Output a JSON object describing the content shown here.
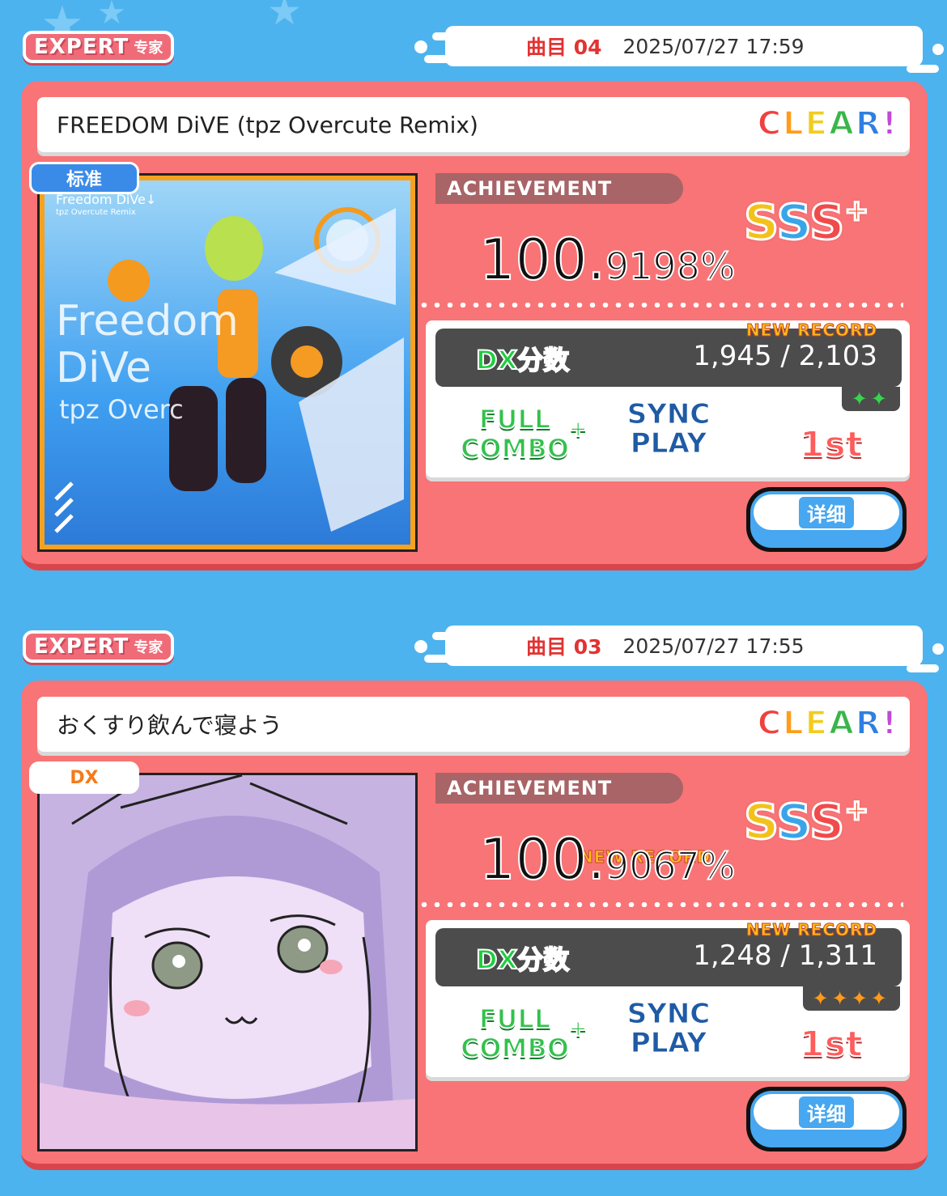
{
  "colors": {
    "background": "#4db3ee",
    "card": "#f87476",
    "accent_red": "#e23333"
  },
  "records": [
    {
      "difficulty_en": "EXPERT",
      "difficulty_zh": "专家",
      "track_label": "曲目 04",
      "date": "2025/07/27 17:59",
      "title": "FREEDOM DiVE (tpz Overcute Remix)",
      "clear_label": "CLEAR!",
      "chart_type": "标准",
      "jacket_text_1": "Freedom DiVe↓",
      "jacket_text_2": "tpz Overcute Remix",
      "jacket_big_1": "Freedom",
      "jacket_big_2": "DiVe",
      "jacket_big_3": "tpz Overc",
      "achievement_label": "ACHIEVEMENT",
      "rank": "SSS",
      "rank_plus": "+",
      "achievement_int": "100.",
      "achievement_dec": "9198%",
      "achievement_new": "",
      "dx_label": "DX分数",
      "dx_value": "1,945 / 2,103",
      "dx_new": "NEW RECORD",
      "dx_stars": "✦✦",
      "fc_line1": "FULL",
      "fc_line2": "COMBO",
      "fc_plus": "+",
      "sync_line1": "SYNC",
      "sync_line2": "PLAY",
      "place": "1st",
      "detail_button": "详细"
    },
    {
      "difficulty_en": "EXPERT",
      "difficulty_zh": "专家",
      "track_label": "曲目 03",
      "date": "2025/07/27 17:55",
      "title": "おくすり飲んで寝よう",
      "clear_label": "CLEAR!",
      "chart_type": "DX",
      "achievement_label": "ACHIEVEMENT",
      "rank": "SSS",
      "rank_plus": "+",
      "achievement_int": "100.",
      "achievement_dec": "9067%",
      "achievement_new": "NEW RECORD",
      "dx_label": "DX分数",
      "dx_value": "1,248 / 1,311",
      "dx_new": "NEW RECORD",
      "dx_stars": "✦✦✦✦",
      "fc_line1": "FULL",
      "fc_line2": "COMBO",
      "fc_plus": "+",
      "sync_line1": "SYNC",
      "sync_line2": "PLAY",
      "place": "1st",
      "detail_button": "详细"
    }
  ]
}
